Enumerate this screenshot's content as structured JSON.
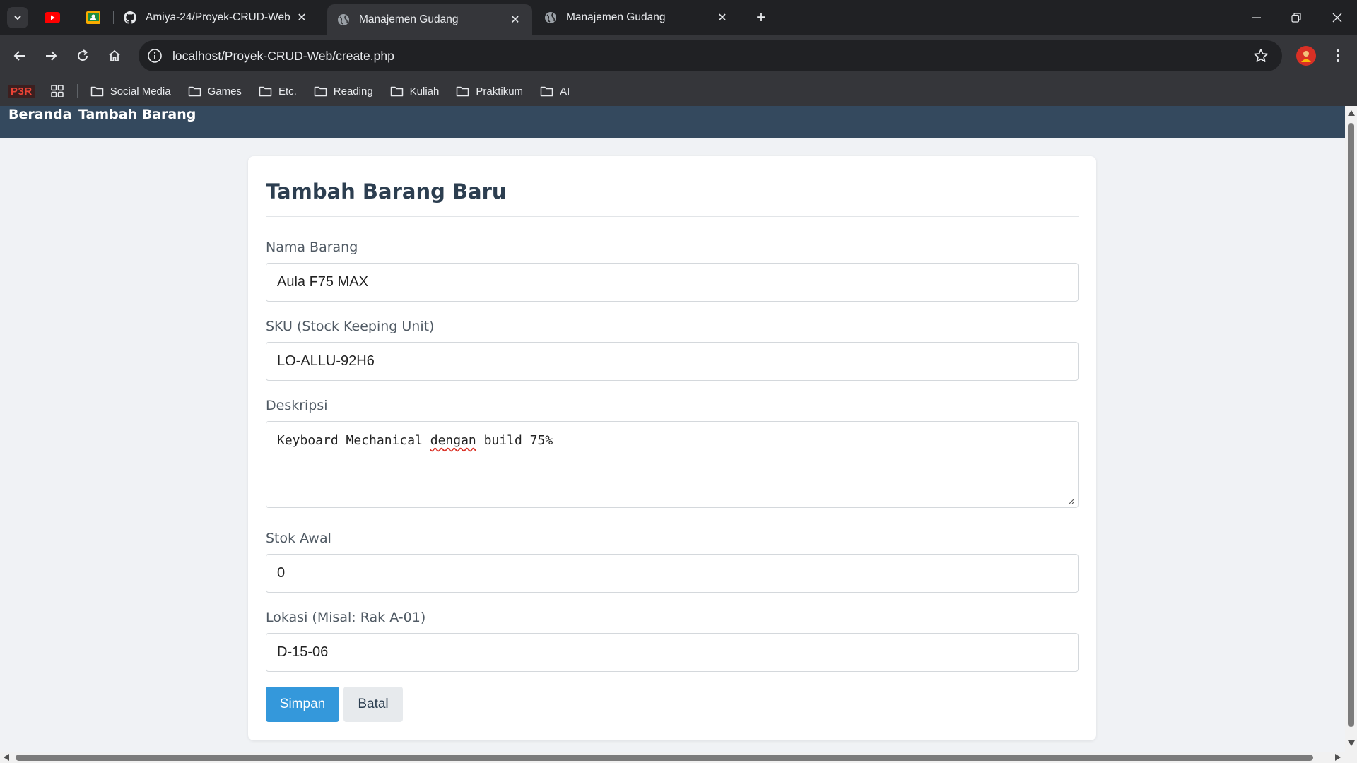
{
  "browser": {
    "tabs": [
      {
        "title": "Amiya-24/Proyek-CRUD-Web",
        "active": false
      },
      {
        "title": "Manajemen Gudang",
        "active": true
      },
      {
        "title": "Manajemen Gudang",
        "active": false
      }
    ],
    "close_glyph": "✕",
    "new_tab_glyph": "+",
    "url": "localhost/Proyek-CRUD-Web/create.php",
    "bookmarks_bar": {
      "p3r": "P3R",
      "folders": [
        "Social Media",
        "Games",
        "Etc.",
        "Reading",
        "Kuliah",
        "Praktikum",
        "AI"
      ]
    }
  },
  "site_nav": {
    "links": [
      "Beranda",
      "Tambah Barang"
    ]
  },
  "form": {
    "title": "Tambah Barang Baru",
    "fields": {
      "nama": {
        "label": "Nama Barang",
        "value": "Aula F75 MAX"
      },
      "sku": {
        "label": "SKU (Stock Keeping Unit)",
        "value": "LO-ALLU-92H6"
      },
      "deskripsi": {
        "label": "Deskripsi",
        "value_before": "Keyboard Mechanical ",
        "value_misspelled": "dengan",
        "value_after": " build 75%"
      },
      "stok": {
        "label": "Stok Awal",
        "value": "0"
      },
      "lokasi": {
        "label": "Lokasi (Misal: Rak A-01)",
        "value": "D-15-06"
      }
    },
    "buttons": {
      "save": "Simpan",
      "cancel": "Batal"
    }
  },
  "colors": {
    "nav_bg": "#34495e",
    "title": "#2c3e50",
    "primary": "#3498db",
    "page_bg": "#f0f2f5"
  }
}
